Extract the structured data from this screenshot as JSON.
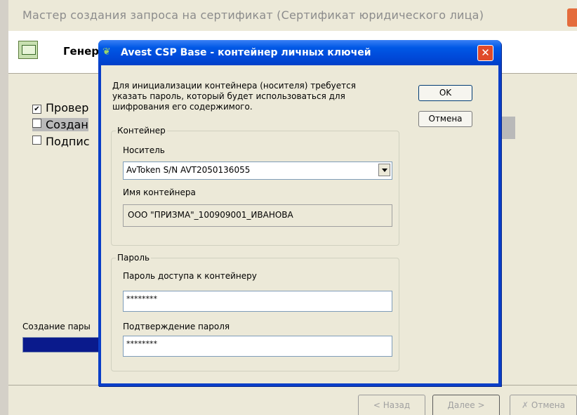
{
  "wizard": {
    "title": "Мастер создания запроса на сертификат (Сертификат юридического лица)",
    "header_title": "Генер",
    "steps": [
      {
        "label": "Провер",
        "checked": true
      },
      {
        "label": "Создан",
        "checked": false
      },
      {
        "label": "Подпис",
        "checked": false
      }
    ],
    "progress_label": "Создание пары",
    "back_button": "< Назад",
    "next_button": "Далее >",
    "cancel_button": "Отмена",
    "cancel_icon": "crossed-icon"
  },
  "dialog": {
    "title": "Avest CSP Base - контейнер личных ключей",
    "intro_text": "Для инициализации контейнера (носителя) требуется указать пароль, который будет использоваться для шифрования его содержимого.",
    "ok_button": "OK",
    "cancel_button": "Отмена",
    "container_group": {
      "title": "Контейнер",
      "media_label": "Носитель",
      "media_value": "AvToken S/N AVT2050136055",
      "name_label": "Имя контейнера",
      "name_value": "ООО \"ПРИЗМА\"_100909001_ИВАНОВА"
    },
    "password_group": {
      "title": "Пароль",
      "password_label": "Пароль доступа к контейнеру",
      "password_value": "********",
      "confirm_label": "Подтверждение пароля",
      "confirm_value": "********"
    }
  }
}
